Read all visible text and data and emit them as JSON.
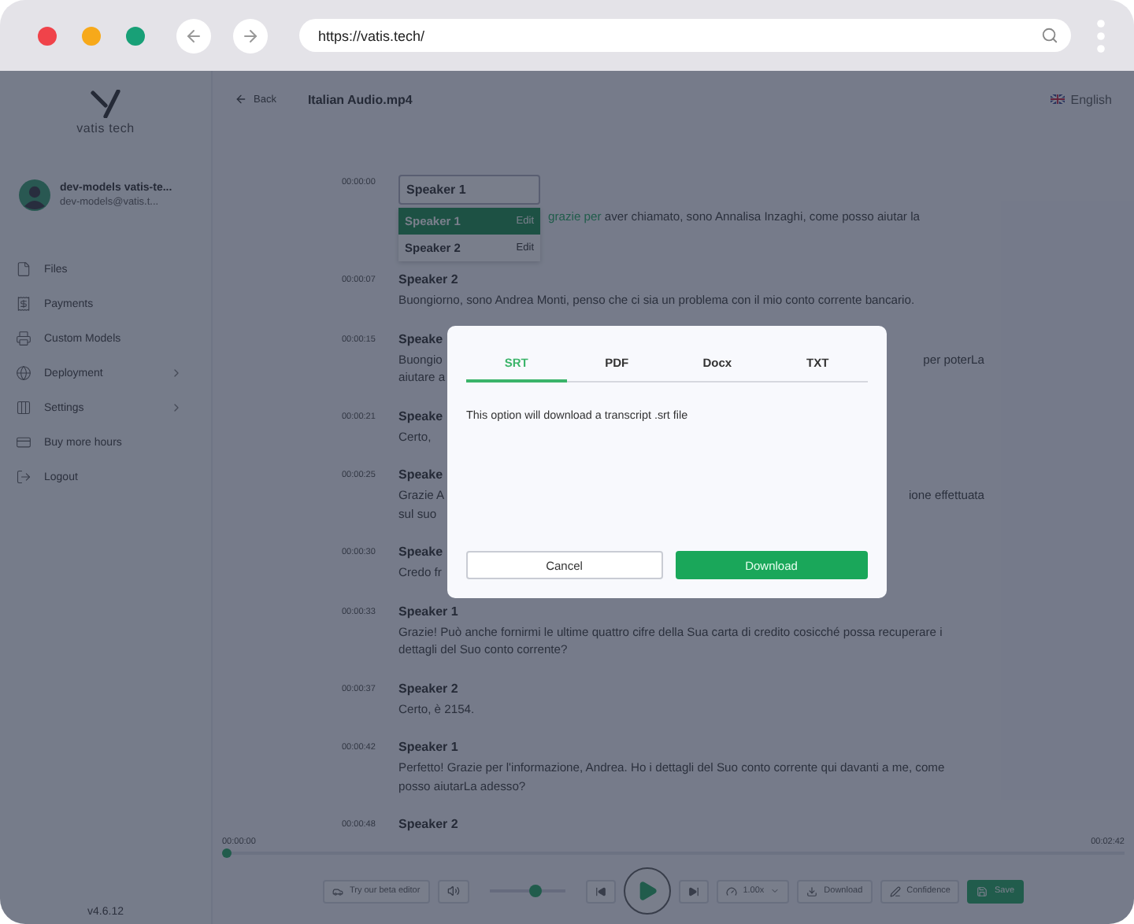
{
  "browser": {
    "url": "https://vatis.tech/"
  },
  "sidebar": {
    "brand": "vatis tech",
    "user": {
      "name": "dev-models vatis-te...",
      "email": "dev-models@vatis.t..."
    },
    "items": [
      {
        "label": "Files",
        "expandable": false
      },
      {
        "label": "Payments",
        "expandable": false
      },
      {
        "label": "Custom Models",
        "expandable": false
      },
      {
        "label": "Deployment",
        "expandable": true
      },
      {
        "label": "Settings",
        "expandable": true
      },
      {
        "label": "Buy more hours",
        "expandable": false
      },
      {
        "label": "Logout",
        "expandable": false
      }
    ],
    "version": "v4.6.12"
  },
  "header": {
    "back": "Back",
    "title": "Italian Audio.mp4",
    "language": "English"
  },
  "speaker_menu": {
    "value": "Speaker 1",
    "options": [
      {
        "label": "Speaker 1",
        "action": "Edit",
        "selected": true
      },
      {
        "label": "Speaker 2",
        "action": "Edit",
        "selected": false
      }
    ]
  },
  "transcript": [
    {
      "time": "00:00:00",
      "kind": "editing",
      "segments": [
        {
          "text": "grazie per",
          "highlighted": true
        },
        {
          "text": " aver chiamato, sono Annalisa Inzaghi, come posso aiutar la",
          "highlighted": false
        }
      ]
    },
    {
      "time": "00:00:07",
      "kind": "full",
      "speaker": "Speaker 2",
      "text": "Buongiorno, sono Andrea Monti, penso che ci sia un problema con il mio conto corrente bancario."
    },
    {
      "time": "00:00:15",
      "kind": "covered",
      "speaker": "Speake",
      "lines": [
        {
          "left": "Buongio",
          "right": "per poterLa"
        },
        {
          "left": "aiutare a"
        }
      ]
    },
    {
      "time": "00:00:21",
      "kind": "covered",
      "speaker": "Speake",
      "lines": [
        {
          "left": "Certo,"
        }
      ]
    },
    {
      "time": "00:00:25",
      "kind": "covered",
      "speaker": "Speake",
      "lines": [
        {
          "left": "Grazie A",
          "right": "ione effettuata"
        },
        {
          "left": "sul suo"
        }
      ]
    },
    {
      "time": "00:00:30",
      "kind": "covered",
      "speaker": "Speake",
      "lines": [
        {
          "left": "Credo fr"
        }
      ]
    },
    {
      "time": "00:00:33",
      "kind": "full",
      "speaker": "Speaker 1",
      "text": "Grazie! Può anche fornirmi le ultime quattro cifre della Sua carta di credito cosicché possa recuperare i dettagli del Suo conto corrente?"
    },
    {
      "time": "00:00:37",
      "kind": "full",
      "speaker": "Speaker 2",
      "text": "Certo, è 2154."
    },
    {
      "time": "00:00:42",
      "kind": "full",
      "speaker": "Speaker 1",
      "text": "Perfetto! Grazie per l'informazione, Andrea. Ho i dettagli del Suo conto corrente qui davanti a me, come posso aiutarLa adesso?"
    },
    {
      "time": "00:00:48",
      "kind": "full",
      "speaker": "Speaker 2"
    }
  ],
  "player": {
    "current": "00:00:00",
    "total": "00:02:42",
    "progress": {
      "level": 0
    },
    "volume": {
      "level": 0.6
    },
    "beta": "Try our beta editor",
    "speed": "1.00x",
    "download": "Download",
    "confidence": "Confidence",
    "save": "Save"
  },
  "dialog": {
    "tabs": [
      {
        "label": "SRT",
        "selected": true
      },
      {
        "label": "PDF",
        "selected": false
      },
      {
        "label": "Docx",
        "selected": false
      },
      {
        "label": "TXT",
        "selected": false
      }
    ],
    "message": "This option will download a transcript .srt file",
    "cancel": "Cancel",
    "confirm": "Download"
  }
}
